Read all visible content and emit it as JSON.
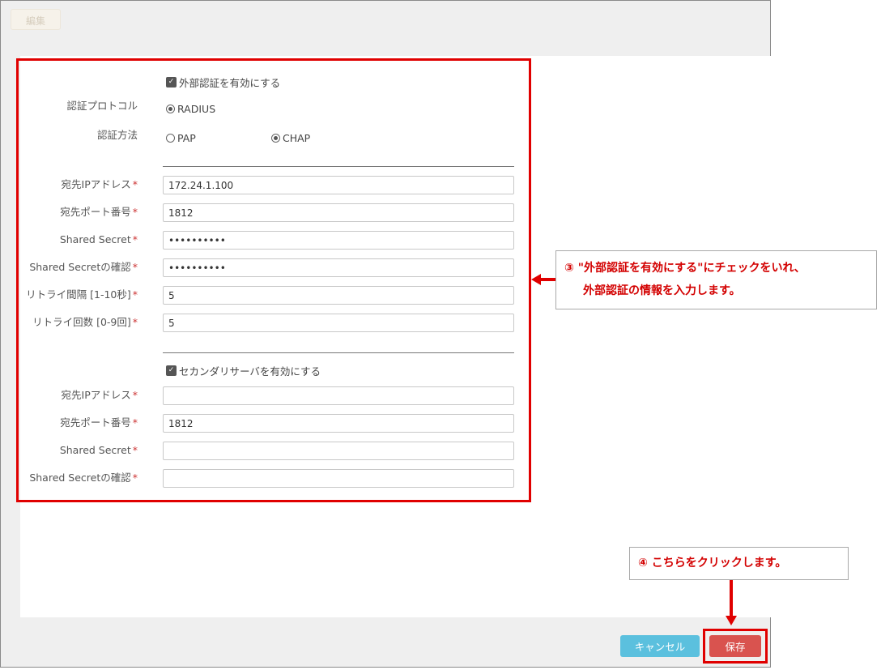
{
  "toolbar": {
    "edit_label": "編集"
  },
  "form": {
    "enable_external_auth": "外部認証を有効にする",
    "auth_protocol_label": "認証プロトコル",
    "auth_protocol_option": "RADIUS",
    "auth_method_label": "認証方法",
    "auth_method_pap": "PAP",
    "auth_method_chap": "CHAP",
    "primary": {
      "dest_ip_label": "宛先IPアドレス",
      "dest_ip_value": "172.24.1.100",
      "dest_port_label": "宛先ポート番号",
      "dest_port_value": "1812",
      "secret_label": "Shared Secret",
      "secret_value": "••••••••••",
      "secret_confirm_label": "Shared Secretの確認",
      "secret_confirm_value": "••••••••••",
      "retry_interval_label": "リトライ間隔 [1-10秒]",
      "retry_interval_value": "5",
      "retry_count_label": "リトライ回数 [0-9回]",
      "retry_count_value": "5"
    },
    "enable_secondary": "セカンダリサーバを有効にする",
    "secondary": {
      "dest_ip_label": "宛先IPアドレス",
      "dest_ip_value": "",
      "dest_port_label": "宛先ポート番号",
      "dest_port_value": "1812",
      "secret_label": "Shared Secret",
      "secret_value": "",
      "secret_confirm_label": "Shared Secretの確認",
      "secret_confirm_value": ""
    },
    "required_mark": "*"
  },
  "annotations": {
    "step3_line1": "③ \"外部認証を有効にする\"にチェックをいれ、",
    "step3_line2": "外部認証の情報を入力します。",
    "step4": "④ こちらをクリックします。"
  },
  "footer": {
    "cancel_label": "キャンセル",
    "save_label": "保存"
  },
  "colors": {
    "highlight": "#e00000",
    "cancel": "#5bc0de",
    "save": "#d9534f"
  }
}
